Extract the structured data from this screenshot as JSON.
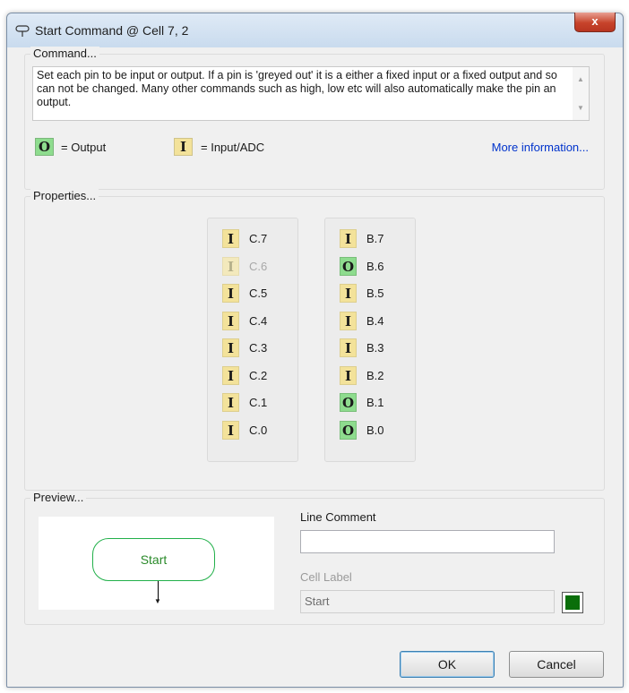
{
  "window": {
    "title": "Start Command @ Cell 7, 2",
    "close_glyph": "x"
  },
  "command": {
    "group_label": "Command...",
    "description": "Set each pin to be input or output. If a pin is 'greyed out' it is a either a fixed input or a fixed output and so can not be changed. Many other commands such as high, low etc will also automatically make the pin an output.",
    "legend": {
      "output_symbol": "O",
      "output_text": "= Output",
      "input_symbol": "I",
      "input_text": "= Input/ADC"
    },
    "more_info": "More information..."
  },
  "properties": {
    "group_label": "Properties...",
    "port_c": [
      {
        "mode": "I",
        "label": "C.7",
        "disabled": false
      },
      {
        "mode": "I",
        "label": "C.6",
        "disabled": true
      },
      {
        "mode": "I",
        "label": "C.5",
        "disabled": false
      },
      {
        "mode": "I",
        "label": "C.4",
        "disabled": false
      },
      {
        "mode": "I",
        "label": "C.3",
        "disabled": false
      },
      {
        "mode": "I",
        "label": "C.2",
        "disabled": false
      },
      {
        "mode": "I",
        "label": "C.1",
        "disabled": false
      },
      {
        "mode": "I",
        "label": "C.0",
        "disabled": false
      }
    ],
    "port_b": [
      {
        "mode": "I",
        "label": "B.7",
        "disabled": false
      },
      {
        "mode": "O",
        "label": "B.6",
        "disabled": false
      },
      {
        "mode": "I",
        "label": "B.5",
        "disabled": false
      },
      {
        "mode": "I",
        "label": "B.4",
        "disabled": false
      },
      {
        "mode": "I",
        "label": "B.3",
        "disabled": false
      },
      {
        "mode": "I",
        "label": "B.2",
        "disabled": false
      },
      {
        "mode": "O",
        "label": "B.1",
        "disabled": false
      },
      {
        "mode": "O",
        "label": "B.0",
        "disabled": false
      }
    ]
  },
  "preview": {
    "group_label": "Preview...",
    "node_text": "Start",
    "line_comment_label": "Line Comment",
    "line_comment_value": "",
    "cell_label_label": "Cell Label",
    "cell_label_value": "Start",
    "cell_color": "#0a6e0a"
  },
  "buttons": {
    "ok": "OK",
    "cancel": "Cancel"
  },
  "colors": {
    "output": "#8edc8e",
    "input": "#f3e29a",
    "link": "#0033cc"
  }
}
